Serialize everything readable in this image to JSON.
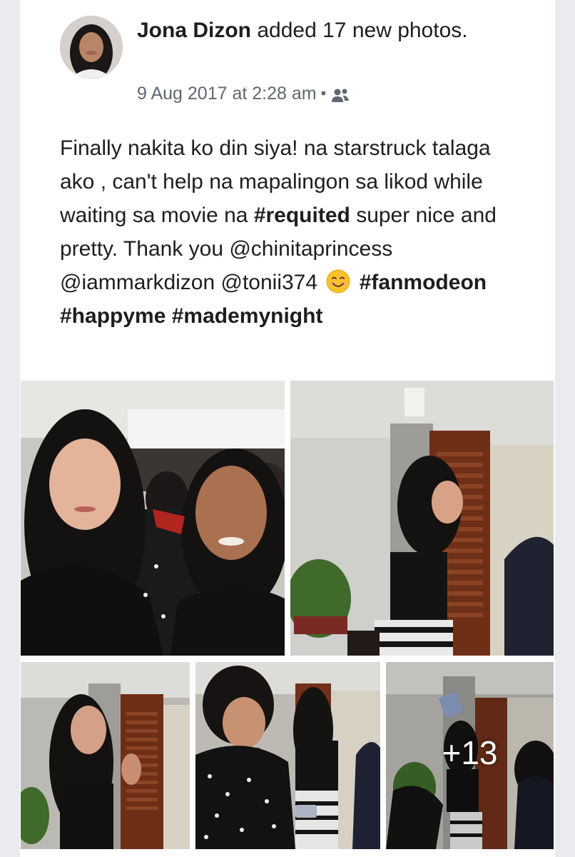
{
  "post": {
    "author": "Jona Dizon",
    "action": "added 17 new photos.",
    "timestamp": "9 Aug 2017 at 2:28 am",
    "separator": "•",
    "audience_icon": "friends-icon",
    "text": {
      "line_intro": "Finally nakita ko din siya! na starstruck talaga ako , can't help na mapalingon sa likod while waiting sa movie na",
      "hashtag_requited": "#requited",
      "mid_text": "super nice and pretty. Thank you @chinitaprincess @iammarkdizon @tonii374",
      "emoji": "smiling-face-icon",
      "hashtag_fanmodeon": "#fanmodeon",
      "hashtag_happyme": "#happyme",
      "hashtag_mademynight": "#mademynight"
    }
  },
  "photos": {
    "more_count_label": "+13"
  },
  "colors": {
    "text_primary": "#1c1e21",
    "text_secondary": "#606770",
    "background": "#e9ebee",
    "card": "#ffffff"
  }
}
